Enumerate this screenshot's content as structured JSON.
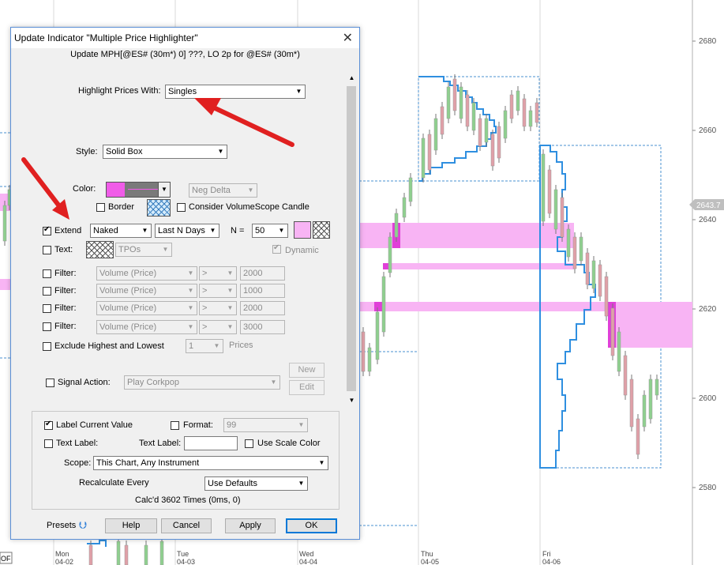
{
  "chart": {
    "y_labels": [
      "2680",
      "2660",
      "2640",
      "2620",
      "2600",
      "2580"
    ],
    "current_price": "2643.7",
    "dates": [
      {
        "day": "Mon",
        "date": "04-02"
      },
      {
        "day": "Tue",
        "date": "04-03"
      },
      {
        "day": "Wed",
        "date": "04-04"
      },
      {
        "day": "Thu",
        "date": "04-05"
      },
      {
        "day": "Fri",
        "date": "04-06"
      }
    ],
    "left_label": "OF",
    "colors": {
      "highlight": "#f8b4f4",
      "highlight_dark": "#e040d8",
      "profile": "#2f8fe0",
      "up": "#8fd08f",
      "down": "#e0a0a8"
    }
  },
  "dialog": {
    "title": "Update Indicator \"Multiple Price Highlighter\"",
    "subtitle": "Update MPH[@ES# (30m*) 0] ???, LO 2p for @ES# (30m*)",
    "highlight_label": "Highlight Prices With:",
    "highlight_value": "Singles",
    "style_label": "Style:",
    "style_value": "Solid Box",
    "color_label": "Color:",
    "color_swatch": "#f05ce8",
    "neg_delta": "Neg Delta",
    "border_label": "Border",
    "consider_label": "Consider VolumeScope Candle",
    "extend_label": "Extend",
    "extend_value": "Naked",
    "lastn_value": "Last N Days",
    "n_label": "N =",
    "n_value": "50",
    "text_label": "Text:",
    "tpos_value": "TPOs",
    "dynamic_label": "Dynamic",
    "filters": [
      {
        "label": "Filter:",
        "field": "Volume (Price)",
        "op": ">",
        "value": "2000"
      },
      {
        "label": "Filter:",
        "field": "Volume (Price)",
        "op": ">",
        "value": "1000"
      },
      {
        "label": "Filter:",
        "field": "Volume (Price)",
        "op": ">",
        "value": "2000"
      },
      {
        "label": "Filter:",
        "field": "Volume (Price)",
        "op": ">",
        "value": "3000"
      }
    ],
    "exclude_label": "Exclude Highest and Lowest",
    "exclude_value": "1",
    "prices_label": "Prices",
    "signal_label": "Signal Action:",
    "signal_value": "Play Corkpop",
    "new_btn": "New",
    "edit_btn": "Edit",
    "label_current": "Label Current Value",
    "format_label": "Format:",
    "format_value": "99",
    "text_label_cb": "Text Label:",
    "text_label_field": "Text Label:",
    "text_label_value": "",
    "use_scale": "Use Scale Color",
    "scope_label": "Scope:",
    "scope_value": "This Chart, Any Instrument",
    "recalc_label": "Recalculate Every",
    "recalc_value": "Use Defaults",
    "calcd": "Calc'd 3602 Times (0ms, 0)",
    "presets": "Presets",
    "help": "Help",
    "cancel": "Cancel",
    "apply": "Apply",
    "ok": "OK"
  }
}
